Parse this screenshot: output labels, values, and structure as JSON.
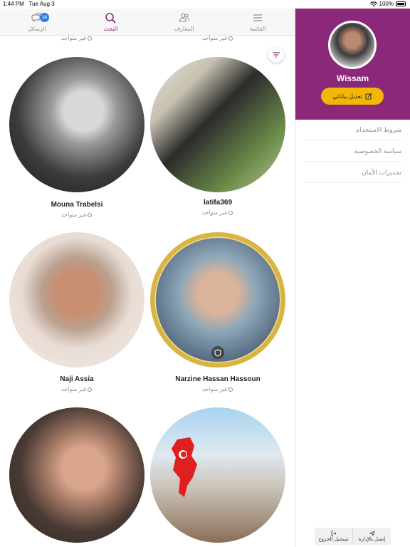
{
  "status": {
    "time": "1:44 PM",
    "date": "Tue Aug 3",
    "battery": "100%"
  },
  "tabs": [
    {
      "label": "الرسائل",
      "icon": "chat-icon",
      "badge": "14"
    },
    {
      "label": "البحث",
      "icon": "search-icon"
    },
    {
      "label": "المعارف",
      "icon": "people-icon"
    },
    {
      "label": "القائمة",
      "icon": "menu-icon"
    }
  ],
  "offline_label": "غير متواجد",
  "users": [
    {
      "name": "Mouna Trabelsi"
    },
    {
      "name": "latifa369"
    },
    {
      "name": "Naji Assia"
    },
    {
      "name": "Narzine Hassan Hassoun"
    }
  ],
  "side": {
    "name": "Wissam",
    "edit_label": "تعديل بياناتي",
    "menu": [
      "شروط الاستخدام",
      "سياسة الخصوصية",
      "تحذيرات الأمان"
    ],
    "logout_label": "تسجيل الخروج",
    "contact_label": "إتصل بالإدارة"
  },
  "colors": {
    "brand": "#8b2879",
    "accent": "#f2b705",
    "badge": "#2b7de9"
  }
}
